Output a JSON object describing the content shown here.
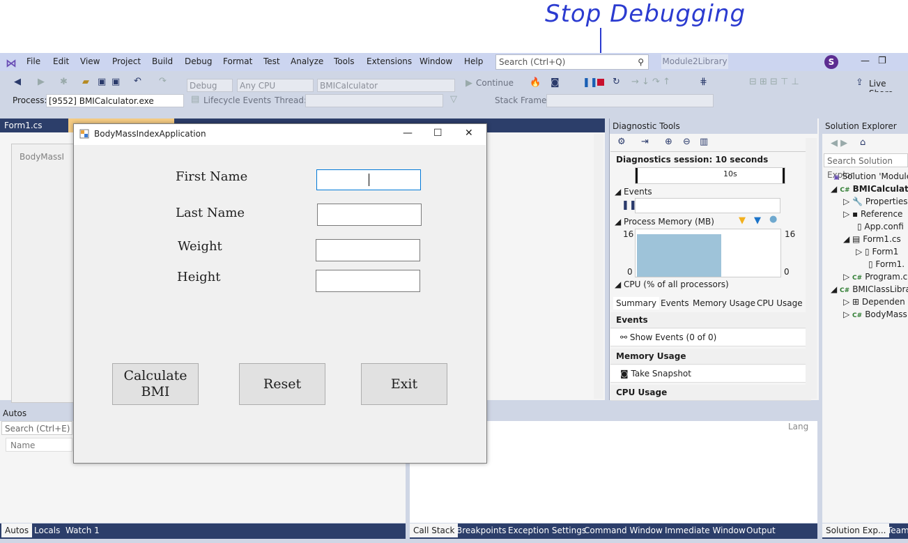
{
  "annotation": {
    "text": "Stop Debugging",
    "color": "#2b3bd0"
  },
  "menu": [
    "File",
    "Edit",
    "View",
    "Project",
    "Build",
    "Debug",
    "Format",
    "Test",
    "Analyze",
    "Tools",
    "Extensions",
    "Window",
    "Help"
  ],
  "search": {
    "placeholder": "Search (Ctrl+Q)"
  },
  "project_name": "Module2Library",
  "avatar_letter": "S",
  "toolbar": {
    "config": "Debug",
    "platform": "Any CPU",
    "startup": "BMICalculator",
    "continue_label": "Continue",
    "live_share": "Live Share",
    "process_label": "Process:",
    "process_value": "[9552] BMICalculator.exe",
    "lifecycle": "Lifecycle Events",
    "thread_label": "Thread:",
    "stack_frame_label": "Stack Frame:"
  },
  "doc_tabs": [
    "Form1.cs"
  ],
  "designer_title": "BodyMassI",
  "diagnostic": {
    "title": "Diagnostic Tools",
    "session": "Diagnostics session: 10 seconds",
    "ruler_mark": "10s",
    "events": "Events",
    "process_memory": "Process Memory (MB)",
    "mem_top": "16",
    "mem_bottom": "0",
    "mem_level": 0.9,
    "cpu": "CPU (% of all processors)",
    "tabs": [
      "Summary",
      "Events",
      "Memory Usage",
      "CPU Usage"
    ],
    "summary_events": "Events",
    "show_events": "Show Events (0 of 0)",
    "summary_memory": "Memory Usage",
    "take_snapshot": "Take Snapshot",
    "summary_cpu": "CPU Usage"
  },
  "solution_explorer": {
    "title": "Solution Explorer",
    "search": "Search Solution Explor",
    "rows": [
      "Solution 'Module",
      "BMICalculato",
      "Properties",
      "Reference",
      "App.confi",
      "Form1.cs",
      "Form1",
      "Form1.",
      "Program.c",
      "BMIClassLibra",
      "Dependen",
      "BodyMass"
    ]
  },
  "autos": {
    "title": "Autos",
    "search": "Search (Ctrl+E)",
    "col_name": "Name",
    "col_lang": "Lang"
  },
  "bottom_left_tabs": [
    "Autos",
    "Locals",
    "Watch 1"
  ],
  "bottom_right_tabs": [
    "Call Stack",
    "Breakpoints",
    "Exception Settings",
    "Command Window",
    "Immediate Window",
    "Output"
  ],
  "solx_tabs": [
    "Solution Exp...",
    "Team"
  ],
  "app": {
    "title": "BodyMassIndexApplication",
    "labels": {
      "first": "First Name",
      "last": "Last Name",
      "weight": "Weight",
      "height": "Height"
    },
    "buttons": {
      "calc": "Calculate\nBMI",
      "reset": "Reset",
      "exit": "Exit"
    }
  }
}
